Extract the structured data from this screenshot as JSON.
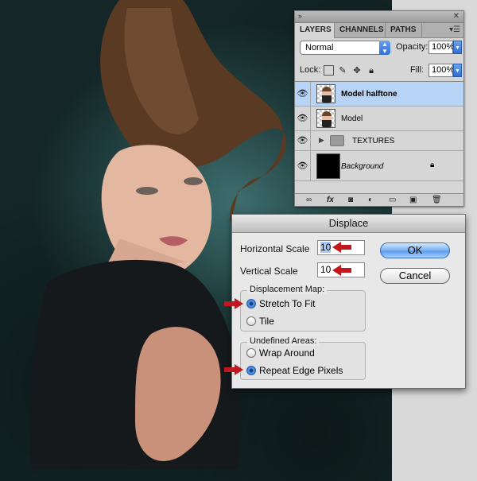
{
  "layers_panel": {
    "tabs": [
      "LAYERS",
      "CHANNELS",
      "PATHS"
    ],
    "blend_mode": "Normal",
    "opacity_label": "Opacity:",
    "opacity_value": "100%",
    "lock_label": "Lock:",
    "fill_label": "Fill:",
    "fill_value": "100%",
    "layers": [
      {
        "name": "Model halftone",
        "selected": true
      },
      {
        "name": "Model",
        "selected": false
      },
      {
        "name": "TEXTURES",
        "selected": false
      },
      {
        "name": "Background",
        "selected": false
      }
    ]
  },
  "displace": {
    "title": "Displace",
    "horizontal_label": "Horizontal Scale",
    "horizontal_value": "10",
    "vertical_label": "Vertical Scale",
    "vertical_value": "10",
    "ok_label": "OK",
    "cancel_label": "Cancel",
    "map_group_title": "Displacement Map:",
    "map_options": [
      "Stretch To Fit",
      "Tile"
    ],
    "undefined_group_title": "Undefined Areas:",
    "undefined_options": [
      "Wrap Around",
      "Repeat Edge Pixels"
    ]
  }
}
